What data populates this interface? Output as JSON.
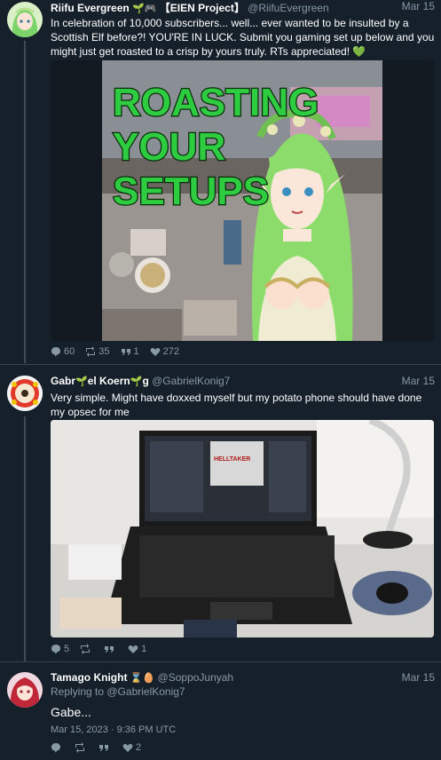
{
  "tweets": [
    {
      "name": "Riifu Evergreen",
      "name_emoji": "🌱🎮",
      "name_suffix": "【EIEN Project】",
      "handle": "@RiifuEvergreen",
      "date": "Mar 15",
      "text": "In celebration of 10,000 subscribers... well... ever wanted to be insulted by a Scottish Elf before?! YOU'RE IN LUCK. Submit you gaming set up below and you might just get roasted to a crisp by yours truly. RTs appreciated! 💚",
      "image_caption": "ROASTING YOUR SETUPS",
      "replies": "60",
      "retweets": "35",
      "quotes": "1",
      "likes": "272"
    },
    {
      "name_part1": "Gabr",
      "name_emoji1": "🌱",
      "name_part2": "el Koern",
      "name_emoji2": "🌱",
      "name_part3": "g",
      "handle": "@GabrielKonig7",
      "date": "Mar 15",
      "text": "Very simple. Might have doxxed myself but my potato phone should have done my opsec for me",
      "laptop_screen_text": "HELLTAKER",
      "replies": "5",
      "retweets": "",
      "quotes": "",
      "likes": "1"
    },
    {
      "name": "Tamago Knight",
      "name_emoji": "⌛🥚",
      "handle": "@SoppoJunyah",
      "date": "Mar 15",
      "replying_prefix": "Replying to ",
      "replying_to": "@GabrielKonig7",
      "text": "Gabe...",
      "timestamp": "Mar 15, 2023 · 9:36 PM UTC",
      "replies": "",
      "retweets": "",
      "quotes": "",
      "likes": "2"
    }
  ],
  "colors": {
    "background": "#15202b",
    "title_green": "#2ecc40",
    "heart": "#27ae60"
  }
}
